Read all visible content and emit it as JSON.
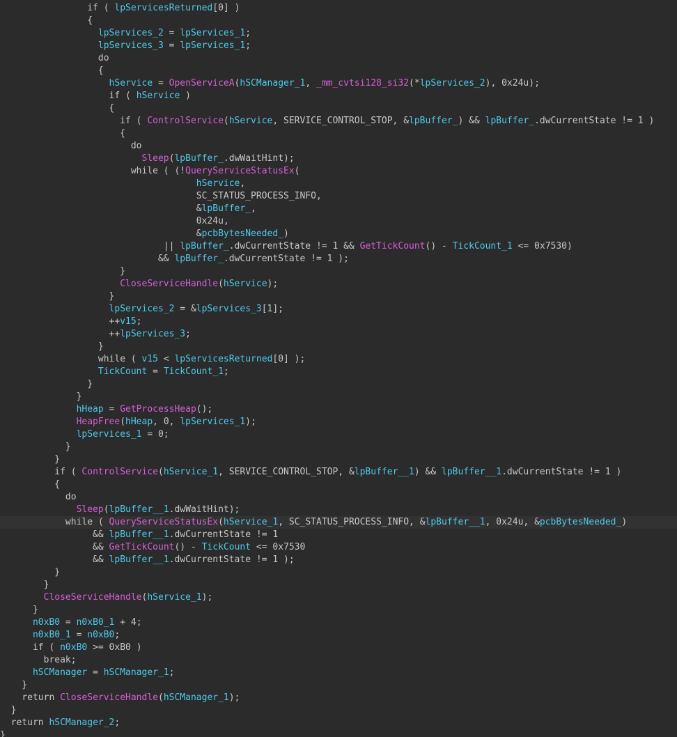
{
  "colors": {
    "background": "#2b2b2b",
    "highlight_line": "#323232",
    "text": "#c8c8c8",
    "function": "#d65fd6",
    "variable": "#4ec9e9"
  },
  "highlighted_line": 41,
  "lines": [
    [
      [
        "plain",
        "                "
      ],
      [
        "kw",
        "if"
      ],
      [
        "plain",
        " ( "
      ],
      [
        "var",
        "lpServicesReturned"
      ],
      [
        "plain",
        "[0] )"
      ]
    ],
    [
      [
        "plain",
        "                {"
      ]
    ],
    [
      [
        "plain",
        "                  "
      ],
      [
        "var",
        "lpServices_2"
      ],
      [
        "plain",
        " = "
      ],
      [
        "var",
        "lpServices_1"
      ],
      [
        "plain",
        ";"
      ]
    ],
    [
      [
        "plain",
        "                  "
      ],
      [
        "var",
        "lpServices_3"
      ],
      [
        "plain",
        " = "
      ],
      [
        "var",
        "lpServices_1"
      ],
      [
        "plain",
        ";"
      ]
    ],
    [
      [
        "plain",
        "                  "
      ],
      [
        "kw",
        "do"
      ]
    ],
    [
      [
        "plain",
        "                  {"
      ]
    ],
    [
      [
        "plain",
        "                    "
      ],
      [
        "var",
        "hService"
      ],
      [
        "plain",
        " = "
      ],
      [
        "func",
        "OpenServiceA"
      ],
      [
        "plain",
        "("
      ],
      [
        "var",
        "hSCManager_1"
      ],
      [
        "plain",
        ", "
      ],
      [
        "func",
        "_mm_cvtsi128_si32"
      ],
      [
        "plain",
        "(*"
      ],
      [
        "var",
        "lpServices_2"
      ],
      [
        "plain",
        "), 0x24u);"
      ]
    ],
    [
      [
        "plain",
        "                    "
      ],
      [
        "kw",
        "if"
      ],
      [
        "plain",
        " ( "
      ],
      [
        "var",
        "hService"
      ],
      [
        "plain",
        " )"
      ]
    ],
    [
      [
        "plain",
        "                    {"
      ]
    ],
    [
      [
        "plain",
        "                      "
      ],
      [
        "kw",
        "if"
      ],
      [
        "plain",
        " ( "
      ],
      [
        "func",
        "ControlService"
      ],
      [
        "plain",
        "("
      ],
      [
        "var",
        "hService"
      ],
      [
        "plain",
        ", SERVICE_CONTROL_STOP, &"
      ],
      [
        "var",
        "lpBuffer_"
      ],
      [
        "plain",
        ") && "
      ],
      [
        "var",
        "lpBuffer_"
      ],
      [
        "plain",
        ".dwCurrentState != 1 )"
      ]
    ],
    [
      [
        "plain",
        "                      {"
      ]
    ],
    [
      [
        "plain",
        "                        "
      ],
      [
        "kw",
        "do"
      ]
    ],
    [
      [
        "plain",
        "                          "
      ],
      [
        "func",
        "Sleep"
      ],
      [
        "plain",
        "("
      ],
      [
        "var",
        "lpBuffer_"
      ],
      [
        "plain",
        ".dwWaitHint);"
      ]
    ],
    [
      [
        "plain",
        "                        "
      ],
      [
        "kw",
        "while"
      ],
      [
        "plain",
        " ( (!"
      ],
      [
        "func",
        "QueryServiceStatusEx"
      ],
      [
        "plain",
        "("
      ]
    ],
    [
      [
        "plain",
        "                                    "
      ],
      [
        "var",
        "hService"
      ],
      [
        "plain",
        ","
      ]
    ],
    [
      [
        "plain",
        "                                    SC_STATUS_PROCESS_INFO,"
      ]
    ],
    [
      [
        "plain",
        "                                    &"
      ],
      [
        "var",
        "lpBuffer_"
      ],
      [
        "plain",
        ","
      ]
    ],
    [
      [
        "plain",
        "                                    0x24u,"
      ]
    ],
    [
      [
        "plain",
        "                                    &"
      ],
      [
        "var",
        "pcbBytesNeeded_"
      ],
      [
        "plain",
        ")"
      ]
    ],
    [
      [
        "plain",
        "                              || "
      ],
      [
        "var",
        "lpBuffer_"
      ],
      [
        "plain",
        ".dwCurrentState != 1 && "
      ],
      [
        "func",
        "GetTickCount"
      ],
      [
        "plain",
        "() - "
      ],
      [
        "var",
        "TickCount_1"
      ],
      [
        "plain",
        " <= 0x7530)"
      ]
    ],
    [
      [
        "plain",
        "                             && "
      ],
      [
        "var",
        "lpBuffer_"
      ],
      [
        "plain",
        ".dwCurrentState != 1 );"
      ]
    ],
    [
      [
        "plain",
        "                      }"
      ]
    ],
    [
      [
        "plain",
        "                      "
      ],
      [
        "func",
        "CloseServiceHandle"
      ],
      [
        "plain",
        "("
      ],
      [
        "var",
        "hService"
      ],
      [
        "plain",
        ");"
      ]
    ],
    [
      [
        "plain",
        "                    }"
      ]
    ],
    [
      [
        "plain",
        "                    "
      ],
      [
        "var",
        "lpServices_2"
      ],
      [
        "plain",
        " = &"
      ],
      [
        "var",
        "lpServices_3"
      ],
      [
        "plain",
        "[1];"
      ]
    ],
    [
      [
        "plain",
        "                    ++"
      ],
      [
        "var",
        "v15"
      ],
      [
        "plain",
        ";"
      ]
    ],
    [
      [
        "plain",
        "                    ++"
      ],
      [
        "var",
        "lpServices_3"
      ],
      [
        "plain",
        ";"
      ]
    ],
    [
      [
        "plain",
        "                  }"
      ]
    ],
    [
      [
        "plain",
        "                  "
      ],
      [
        "kw",
        "while"
      ],
      [
        "plain",
        " ( "
      ],
      [
        "var",
        "v15"
      ],
      [
        "plain",
        " < "
      ],
      [
        "var",
        "lpServicesReturned"
      ],
      [
        "plain",
        "[0] );"
      ]
    ],
    [
      [
        "plain",
        "                  "
      ],
      [
        "var",
        "TickCount"
      ],
      [
        "plain",
        " = "
      ],
      [
        "var",
        "TickCount_1"
      ],
      [
        "plain",
        ";"
      ]
    ],
    [
      [
        "plain",
        "                }"
      ]
    ],
    [
      [
        "plain",
        "              }"
      ]
    ],
    [
      [
        "plain",
        "              "
      ],
      [
        "var",
        "hHeap"
      ],
      [
        "plain",
        " = "
      ],
      [
        "func",
        "GetProcessHeap"
      ],
      [
        "plain",
        "();"
      ]
    ],
    [
      [
        "plain",
        "              "
      ],
      [
        "func",
        "HeapFree"
      ],
      [
        "plain",
        "("
      ],
      [
        "var",
        "hHeap"
      ],
      [
        "plain",
        ", 0, "
      ],
      [
        "var",
        "lpServices_1"
      ],
      [
        "plain",
        ");"
      ]
    ],
    [
      [
        "plain",
        "              "
      ],
      [
        "var",
        "lpServices_1"
      ],
      [
        "plain",
        " = 0;"
      ]
    ],
    [
      [
        "plain",
        "            }"
      ]
    ],
    [
      [
        "plain",
        "          }"
      ]
    ],
    [
      [
        "plain",
        "          "
      ],
      [
        "kw",
        "if"
      ],
      [
        "plain",
        " ( "
      ],
      [
        "func",
        "ControlService"
      ],
      [
        "plain",
        "("
      ],
      [
        "var",
        "hService_1"
      ],
      [
        "plain",
        ", SERVICE_CONTROL_STOP, &"
      ],
      [
        "var",
        "lpBuffer__1"
      ],
      [
        "plain",
        ") && "
      ],
      [
        "var",
        "lpBuffer__1"
      ],
      [
        "plain",
        ".dwCurrentState != 1 )"
      ]
    ],
    [
      [
        "plain",
        "          {"
      ]
    ],
    [
      [
        "plain",
        "            "
      ],
      [
        "kw",
        "do"
      ]
    ],
    [
      [
        "plain",
        "              "
      ],
      [
        "func",
        "Sleep"
      ],
      [
        "plain",
        "("
      ],
      [
        "var",
        "lpBuffer__1"
      ],
      [
        "plain",
        ".dwWaitHint);"
      ]
    ],
    [
      [
        "plain",
        "            "
      ],
      [
        "kw",
        "while"
      ],
      [
        "plain",
        " ( "
      ],
      [
        "func",
        "QueryServiceStatusEx"
      ],
      [
        "plain",
        "("
      ],
      [
        "var",
        "hService_1"
      ],
      [
        "plain",
        ", SC_STATUS_PROCESS_INFO, &"
      ],
      [
        "var",
        "lpBuffer__1"
      ],
      [
        "plain",
        ", 0x24u, &"
      ],
      [
        "var",
        "pcbBytesNeeded_"
      ],
      [
        "plain",
        ")"
      ]
    ],
    [
      [
        "plain",
        "                 && "
      ],
      [
        "var",
        "lpBuffer__1"
      ],
      [
        "plain",
        ".dwCurrentState != 1"
      ]
    ],
    [
      [
        "plain",
        "                 && "
      ],
      [
        "func",
        "GetTickCount"
      ],
      [
        "plain",
        "() - "
      ],
      [
        "var",
        "TickCount"
      ],
      [
        "plain",
        " <= 0x7530"
      ]
    ],
    [
      [
        "plain",
        "                 && "
      ],
      [
        "var",
        "lpBuffer__1"
      ],
      [
        "plain",
        ".dwCurrentState != 1 );"
      ]
    ],
    [
      [
        "plain",
        "          }"
      ]
    ],
    [
      [
        "plain",
        "        }"
      ]
    ],
    [
      [
        "plain",
        "        "
      ],
      [
        "func",
        "CloseServiceHandle"
      ],
      [
        "plain",
        "("
      ],
      [
        "var",
        "hService_1"
      ],
      [
        "plain",
        ");"
      ]
    ],
    [
      [
        "plain",
        "      }"
      ]
    ],
    [
      [
        "plain",
        "      "
      ],
      [
        "var",
        "n0xB0"
      ],
      [
        "plain",
        " = "
      ],
      [
        "var",
        "n0xB0_1"
      ],
      [
        "plain",
        " + 4;"
      ]
    ],
    [
      [
        "plain",
        "      "
      ],
      [
        "var",
        "n0xB0_1"
      ],
      [
        "plain",
        " = "
      ],
      [
        "var",
        "n0xB0"
      ],
      [
        "plain",
        ";"
      ]
    ],
    [
      [
        "plain",
        "      "
      ],
      [
        "kw",
        "if"
      ],
      [
        "plain",
        " ( "
      ],
      [
        "var",
        "n0xB0"
      ],
      [
        "plain",
        " >= 0xB0 )"
      ]
    ],
    [
      [
        "plain",
        "        "
      ],
      [
        "kw",
        "break"
      ],
      [
        "plain",
        ";"
      ]
    ],
    [
      [
        "plain",
        "      "
      ],
      [
        "var",
        "hSCManager"
      ],
      [
        "plain",
        " = "
      ],
      [
        "var",
        "hSCManager_1"
      ],
      [
        "plain",
        ";"
      ]
    ],
    [
      [
        "plain",
        "    }"
      ]
    ],
    [
      [
        "plain",
        "    "
      ],
      [
        "kw",
        "return"
      ],
      [
        "plain",
        " "
      ],
      [
        "func",
        "CloseServiceHandle"
      ],
      [
        "plain",
        "("
      ],
      [
        "var",
        "hSCManager_1"
      ],
      [
        "plain",
        ");"
      ]
    ],
    [
      [
        "plain",
        "  }"
      ]
    ],
    [
      [
        "plain",
        "  "
      ],
      [
        "kw",
        "return"
      ],
      [
        "plain",
        " "
      ],
      [
        "var",
        "hSCManager_2"
      ],
      [
        "plain",
        ";"
      ]
    ],
    [
      [
        "plain",
        "}"
      ]
    ]
  ]
}
